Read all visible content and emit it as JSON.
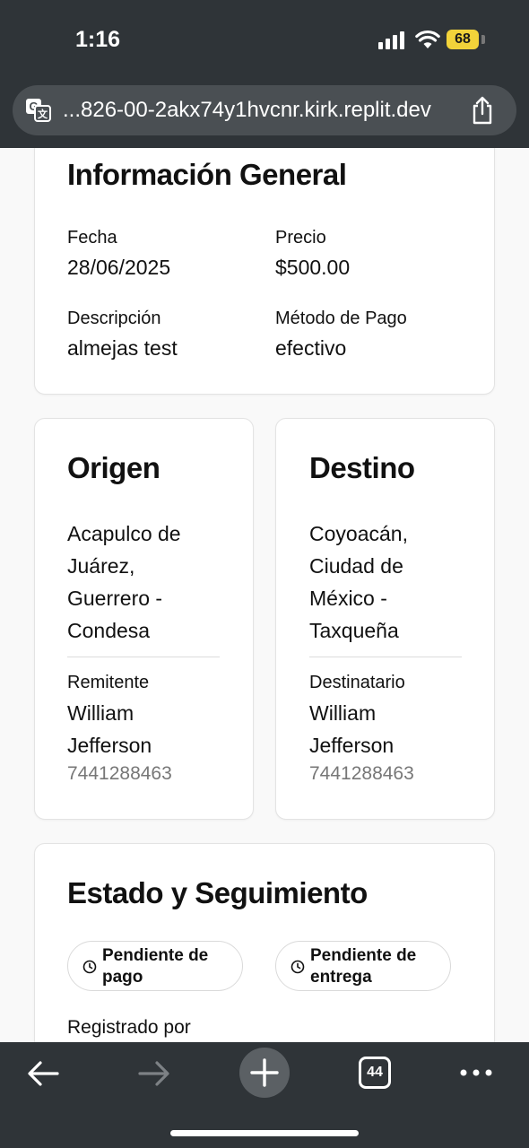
{
  "status_bar": {
    "time": "1:16",
    "battery": "68"
  },
  "browser": {
    "url": "...826-00-2akx74y1hvcnr.kirk.replit.dev",
    "tabs_count": "44"
  },
  "general": {
    "title": "Información General",
    "fecha_label": "Fecha",
    "fecha_value": "28/06/2025",
    "precio_label": "Precio",
    "precio_value": "$500.00",
    "descripcion_label": "Descripción",
    "descripcion_value": "almejas test",
    "metodo_label": "Método de Pago",
    "metodo_value": "efectivo"
  },
  "origen": {
    "title": "Origen",
    "address_lines": [
      "Acapulco de",
      "Juárez,",
      "Guerrero -",
      "Condesa"
    ],
    "person_label": "Remitente",
    "person_lines": [
      "William",
      "Jefferson"
    ],
    "phone": "7441288463"
  },
  "destino": {
    "title": "Destino",
    "address_lines": [
      "Coyoacán,",
      "Ciudad de",
      "México -",
      "Taxqueña"
    ],
    "person_label": "Destinatario",
    "person_lines": [
      "William",
      "Jefferson"
    ],
    "phone": "7441288463"
  },
  "estado": {
    "title": "Estado y Seguimiento",
    "badges": [
      {
        "lines": [
          "Pendiente de",
          "pago"
        ]
      },
      {
        "lines": [
          "Pendiente de",
          "entrega"
        ]
      }
    ],
    "registrado_label": "Registrado por"
  },
  "colors": {
    "chrome": "#2f3438",
    "url_bar": "#4a4f53",
    "battery": "#f2d33a",
    "page_bg": "#f9f9f9"
  }
}
